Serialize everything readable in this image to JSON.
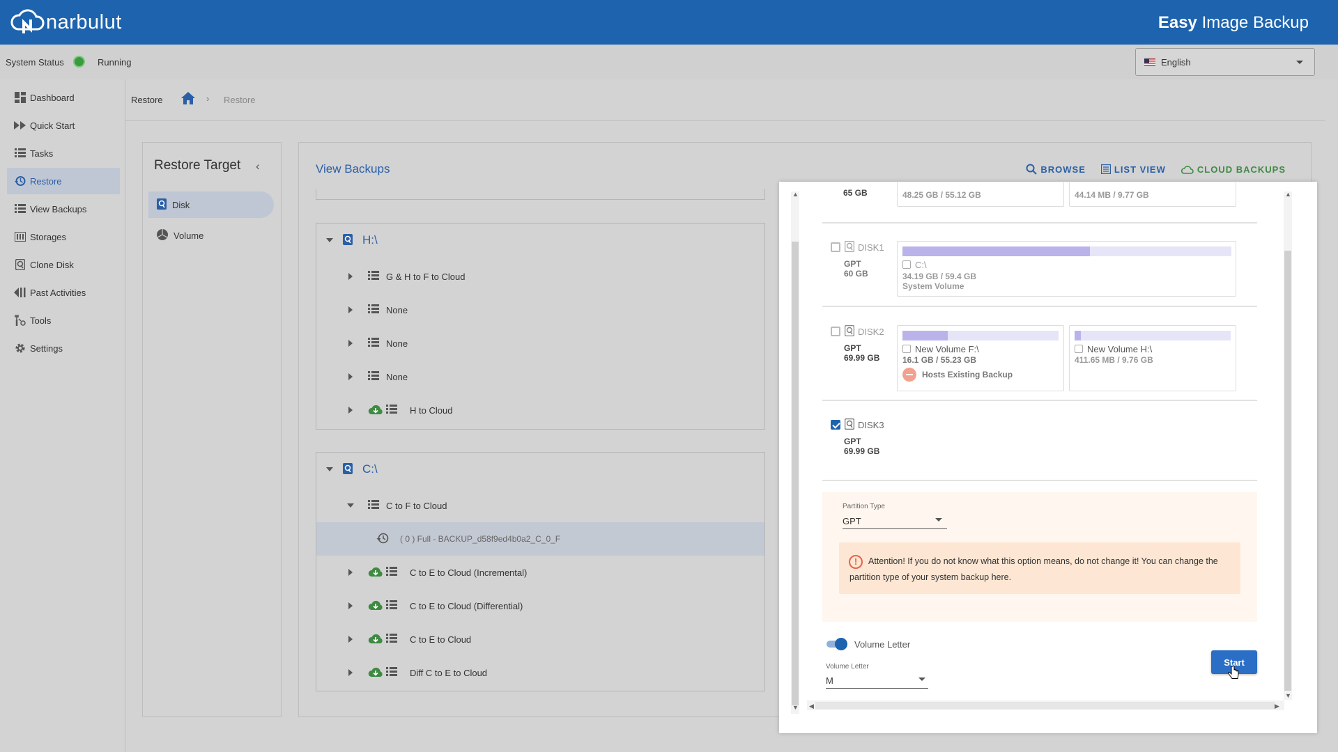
{
  "app": {
    "logo_text": "narbulut",
    "title_bold": "Easy",
    "title_rest": " Image Backup"
  },
  "status": {
    "label": "System Status",
    "value": "Running",
    "color": "#3a9b3e"
  },
  "language": {
    "selected": "English"
  },
  "sidebar": {
    "items": [
      {
        "label": "Dashboard",
        "icon": "dashboard-icon"
      },
      {
        "label": "Quick Start",
        "icon": "fast-forward-icon"
      },
      {
        "label": "Tasks",
        "icon": "list-icon"
      },
      {
        "label": "Restore",
        "icon": "restore-icon",
        "active": true
      },
      {
        "label": "View Backups",
        "icon": "list-icon"
      },
      {
        "label": "Storages",
        "icon": "storage-icon"
      },
      {
        "label": "Clone Disk",
        "icon": "disk-icon"
      },
      {
        "label": "Past Activities",
        "icon": "rewind-icon"
      },
      {
        "label": "Tools",
        "icon": "tools-icon"
      },
      {
        "label": "Settings",
        "icon": "gear-icon"
      }
    ]
  },
  "breadcrumb": {
    "title": "Restore",
    "separator": "›",
    "current": "Restore"
  },
  "restore_target": {
    "title": "Restore Target",
    "items": [
      {
        "label": "Disk",
        "active": true
      },
      {
        "label": "Volume"
      }
    ]
  },
  "view_backups": {
    "title": "View Backups",
    "actions": [
      {
        "label": "BROWSE"
      },
      {
        "label": "LIST VIEW"
      },
      {
        "label": "CLOUD BACKUPS"
      }
    ],
    "groups": [
      {
        "name": "H:\\",
        "rows": [
          {
            "label": "G & H to F to Cloud",
            "cloud": false
          },
          {
            "label": "None",
            "cloud": false
          },
          {
            "label": "None",
            "cloud": false
          },
          {
            "label": "None",
            "cloud": false
          },
          {
            "label": "H to Cloud",
            "cloud": true
          }
        ]
      },
      {
        "name": "C:\\",
        "rows": [
          {
            "label": "C to F to Cloud",
            "cloud": false,
            "expanded": true
          },
          {
            "label": "( 0 ) Full - BACKUP_d58f9ed4b0a2_C_0_F",
            "child": true,
            "selected": true
          },
          {
            "label": "C to E to Cloud (Incremental)",
            "cloud": true
          },
          {
            "label": "C to E to Cloud (Differential)",
            "cloud": true
          },
          {
            "label": "C to E to Cloud",
            "cloud": true
          },
          {
            "label": "Diff C to E to Cloud",
            "cloud": true
          }
        ]
      }
    ]
  },
  "dialog": {
    "top_disk": {
      "size": "65 GB",
      "vol1_size": "48.25 GB / 55.12 GB",
      "vol2_size": "44.14 MB / 9.77 GB"
    },
    "disks": [
      {
        "name": "DISK1",
        "scheme": "GPT",
        "size": "60 GB",
        "checked": false,
        "volumes": [
          {
            "name": "C:\\",
            "size": "34.19 GB / 59.4 GB",
            "extra": "System Volume",
            "usage": 0.57
          }
        ]
      },
      {
        "name": "DISK2",
        "scheme": "GPT",
        "size": "69.99 GB",
        "checked": false,
        "volumes": [
          {
            "name": "New Volume F:\\",
            "size": "16.1 GB / 55.23 GB",
            "extra": "Hosts Existing Backup",
            "usage": 0.29
          },
          {
            "name": "New Volume H:\\",
            "size": "411.65 MB / 9.76 GB",
            "usage": 0.04
          }
        ]
      },
      {
        "name": "DISK3",
        "scheme": "GPT",
        "size": "69.99 GB",
        "checked": true
      }
    ],
    "partition_type": {
      "label": "Partition Type",
      "value": "GPT"
    },
    "attention": "Attention! If you do not know what this option means, do not change it! You can change the partition type of your system backup here.",
    "volume_letter_toggle": {
      "label": "Volume Letter",
      "on": true
    },
    "volume_letter": {
      "label": "Volume Letter",
      "value": "M"
    },
    "start_label": "Start"
  }
}
